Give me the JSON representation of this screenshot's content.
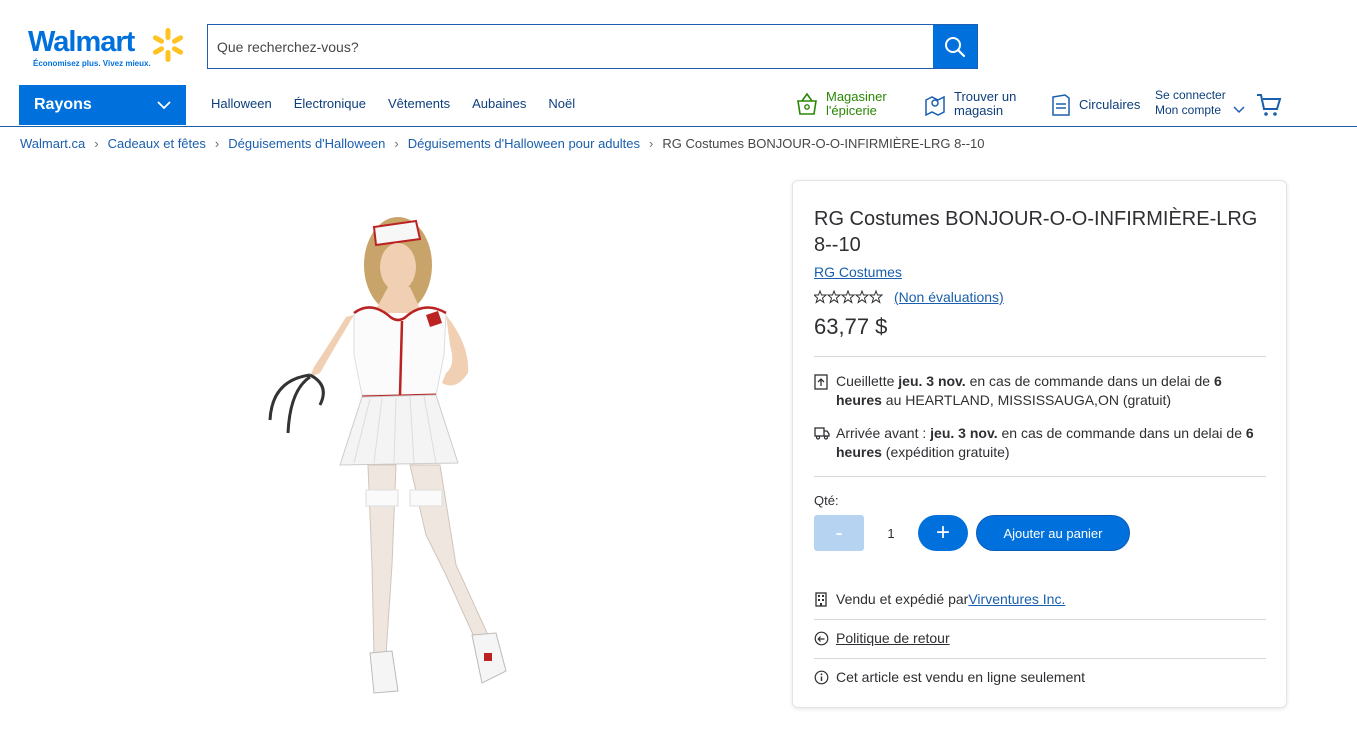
{
  "header": {
    "logo_word": "Walmart",
    "logo_tagline": "Économisez plus. Vivez mieux.",
    "search_placeholder": "Que recherchez-vous?",
    "departments_label": "Rayons",
    "nav": [
      "Halloween",
      "Électronique",
      "Vêtements",
      "Aubaines",
      "Noël"
    ],
    "grocery_line1": "Magasiner",
    "grocery_line2": "l'épicerie",
    "store_line1": "Trouver un",
    "store_line2": "magasin",
    "flyers": "Circulaires",
    "account_line1": "Se connecter",
    "account_line2": "Mon compte"
  },
  "breadcrumb": [
    "Walmart.ca",
    "Cadeaux et fêtes",
    "Déguisements d'Halloween",
    "Déguisements d'Halloween pour adultes"
  ],
  "breadcrumb_current": "RG Costumes BONJOUR-O-O-INFIRMIÈRE-LRG 8--10",
  "product": {
    "title": "RG Costumes BONJOUR-O-O-INFIRMIÈRE-LRG 8--10",
    "brand": "RG Costumes",
    "reviews": "(Non évaluations)",
    "rating": 0,
    "price": "63,77 $",
    "pickup": {
      "pre": "Cueillette ",
      "date": "jeu. 3 nov.",
      "mid": " en cas de commande dans un delai de ",
      "hours": "6 heures",
      "post": " au HEARTLAND, MISSISSAUGA,ON (gratuit)"
    },
    "delivery": {
      "pre": "Arrivée avant : ",
      "date": "jeu. 3 nov.",
      "mid": " en cas de commande dans un delai de ",
      "hours": "6 heures",
      "post": " (expédition gratuite)"
    },
    "qty_label": "Qté:",
    "qty_minus": "-",
    "qty_value": "1",
    "qty_plus": "+",
    "add_to_cart": "Ajouter au panier",
    "sold_by_pre": "Vendu et expédié par ",
    "seller": "Virventures Inc.",
    "return_policy": "Politique de retour",
    "online_only": "Cet article est vendu en ligne seulement"
  },
  "colors": {
    "brand_blue": "#0071dc",
    "spark_yellow": "#ffc220",
    "link_blue": "#1a5fae",
    "grocery_green": "#2a8703"
  }
}
